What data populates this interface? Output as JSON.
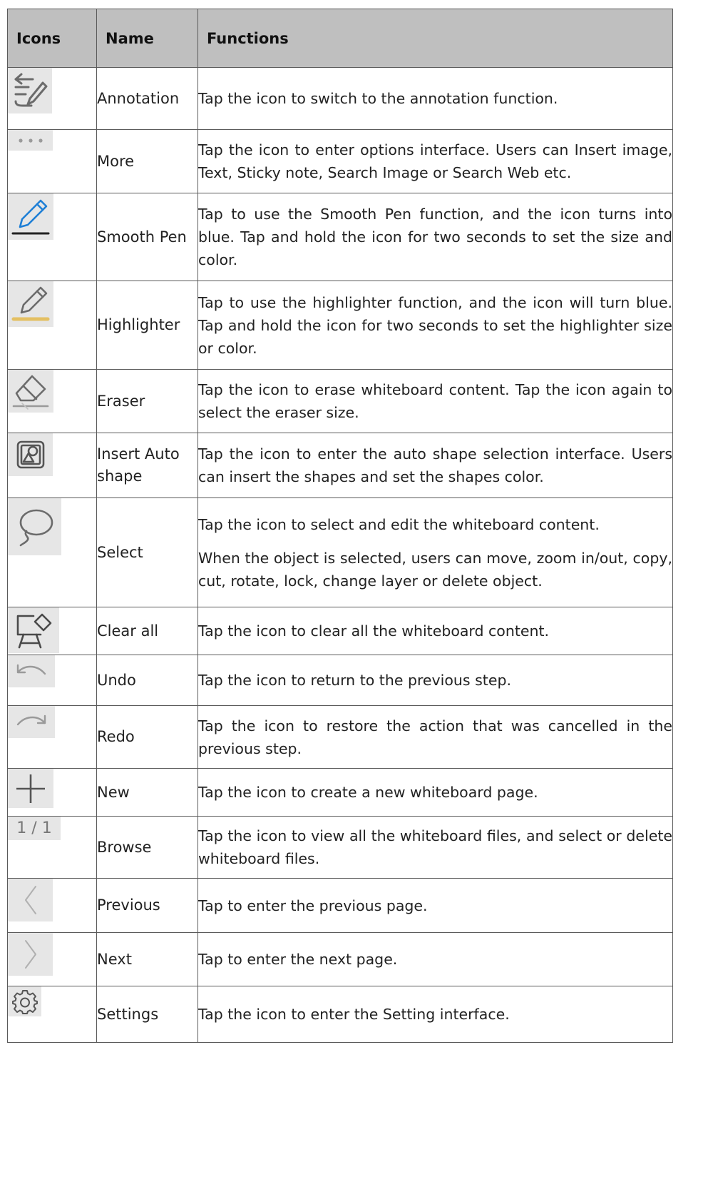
{
  "table": {
    "headers": {
      "icons": "Icons",
      "name": "Name",
      "functions": "Functions"
    },
    "rows": [
      {
        "icon": "annotation-icon",
        "name": "Annotation",
        "description": [
          "Tap the icon to switch to the annotation function."
        ]
      },
      {
        "icon": "more-icon",
        "name": "More",
        "description": [
          "Tap the icon to enter options interface. Users can Insert image, Text, Sticky note, Search Image or Search Web etc."
        ]
      },
      {
        "icon": "smooth-pen-icon",
        "name": "Smooth Pen",
        "description": [
          "Tap to use the Smooth Pen function, and the icon turns into blue. Tap and hold the icon for two seconds to set the size and color."
        ]
      },
      {
        "icon": "highlighter-icon",
        "name": "Highlighter",
        "description": [
          "Tap to use the highlighter function, and the icon will turn blue. Tap and hold the icon for two seconds to set the highlighter size or color."
        ]
      },
      {
        "icon": "eraser-icon",
        "name": "Eraser",
        "description": [
          "Tap the icon to erase whiteboard content. Tap the icon again to select the eraser size."
        ]
      },
      {
        "icon": "auto-shape-icon",
        "name": "Insert Auto shape",
        "description": [
          "Tap the icon to enter the auto shape selection interface. Users can insert the shapes and set the shapes color."
        ]
      },
      {
        "icon": "lasso-select-icon",
        "name": "Select",
        "description": [
          "Tap the icon to select and edit the whiteboard content.",
          "When the object is selected, users can move, zoom in/out, copy, cut, rotate, lock, change layer or delete object."
        ]
      },
      {
        "icon": "clear-board-icon",
        "name": "Clear all",
        "description": [
          "Tap the icon to clear all the whiteboard content."
        ]
      },
      {
        "icon": "undo-icon",
        "name": "Undo",
        "description": [
          "Tap the icon to return to the previous step."
        ]
      },
      {
        "icon": "redo-icon",
        "name": "Redo",
        "description": [
          "Tap the icon to restore the action that was cancelled in the previous step."
        ]
      },
      {
        "icon": "plus-icon",
        "name": "New",
        "description": [
          "Tap the icon to create a new whiteboard page."
        ]
      },
      {
        "icon": "page-counter-icon",
        "name": "Browse",
        "icon_text": "1 / 1",
        "description": [
          "Tap the icon to view all the whiteboard files, and select or delete whiteboard files."
        ]
      },
      {
        "icon": "chevron-left-icon",
        "name": "Previous",
        "description": [
          "Tap to enter the previous page."
        ]
      },
      {
        "icon": "chevron-right-icon",
        "name": "Next",
        "description": [
          "Tap to enter the next page."
        ]
      },
      {
        "icon": "gear-icon",
        "name": "Settings",
        "description": [
          "Tap the icon to enter the Setting interface."
        ]
      }
    ]
  },
  "colors": {
    "header_bg": "#bfbfbf",
    "icon_bg": "#e6e6e6",
    "pen_blue": "#1e7fd6",
    "highlight_yellow": "#e3b84a"
  }
}
